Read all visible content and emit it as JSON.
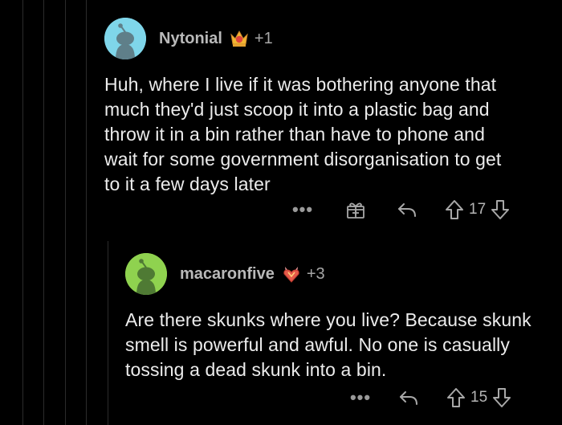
{
  "comments": [
    {
      "username": "Nytonial",
      "award_count": "+1",
      "avatar_color": "#7fd6ea",
      "body": "Huh, where I live if it was bothering anyone that much they'd just scoop it into a plastic bag and throw it in a bin rather than have to phone and wait for some government disorganisation to get to it a few days later",
      "more_label": "•••",
      "vote_count": "17",
      "icons": {
        "award": "crown-award-icon",
        "gift": "gift-icon",
        "reply": "reply-icon",
        "upvote": "upvote-arrow-icon",
        "downvote": "downvote-arrow-icon"
      }
    },
    {
      "username": "macaronfive",
      "award_count": "+3",
      "avatar_color": "#8fd24f",
      "body": "Are there skunks where you live?  Because skunk smell is powerful and awful.  No one is casually tossing a dead skunk into a bin.",
      "more_label": "•••",
      "vote_count": "15",
      "icons": {
        "award": "crystal-heart-award-icon",
        "reply": "reply-icon",
        "upvote": "upvote-arrow-icon",
        "downvote": "downvote-arrow-icon"
      }
    }
  ],
  "colors": {
    "background": "#000000",
    "thread_line": "#2b2b2b",
    "text": "#ececec",
    "muted": "#9a9a9a"
  }
}
